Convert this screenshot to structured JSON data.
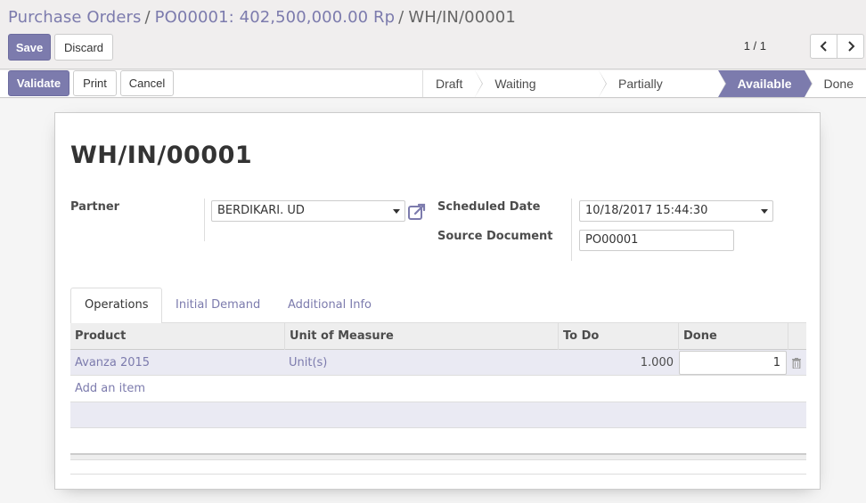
{
  "breadcrumb": {
    "items": [
      "Purchase Orders",
      "PO00001: 402,500,000.00 Rp"
    ],
    "current": "WH/IN/00001",
    "separator": "/"
  },
  "toolbar": {
    "save_label": "Save",
    "discard_label": "Discard"
  },
  "pager": {
    "value": "1 / 1",
    "prev_icon": "chevron-left-icon",
    "next_icon": "chevron-right-icon"
  },
  "actions": {
    "validate_label": "Validate",
    "print_label": "Print",
    "cancel_label": "Cancel"
  },
  "status": {
    "stages": [
      "Draft",
      "Waiting Availability",
      "Partially Available",
      "Available",
      "Done"
    ],
    "active": "Available"
  },
  "record": {
    "name": "WH/IN/00001",
    "partner_label": "Partner",
    "partner_value": "BERDIKARI. UD",
    "scheduled_date_label": "Scheduled Date",
    "scheduled_date_value": "10/18/2017 15:44:30",
    "source_document_label": "Source Document",
    "source_document_value": "PO00001"
  },
  "tabs": [
    "Operations",
    "Initial Demand",
    "Additional Info"
  ],
  "table": {
    "columns": [
      "Product",
      "Unit of Measure",
      "To Do",
      "Done"
    ],
    "rows": [
      {
        "product": "Avanza 2015",
        "uom": "Unit(s)",
        "todo": "1.000",
        "done": "1"
      }
    ],
    "add_item_label": "Add an item"
  },
  "colors": {
    "accent": "#7c7bad",
    "row_highlight": "#eaeaf3"
  }
}
